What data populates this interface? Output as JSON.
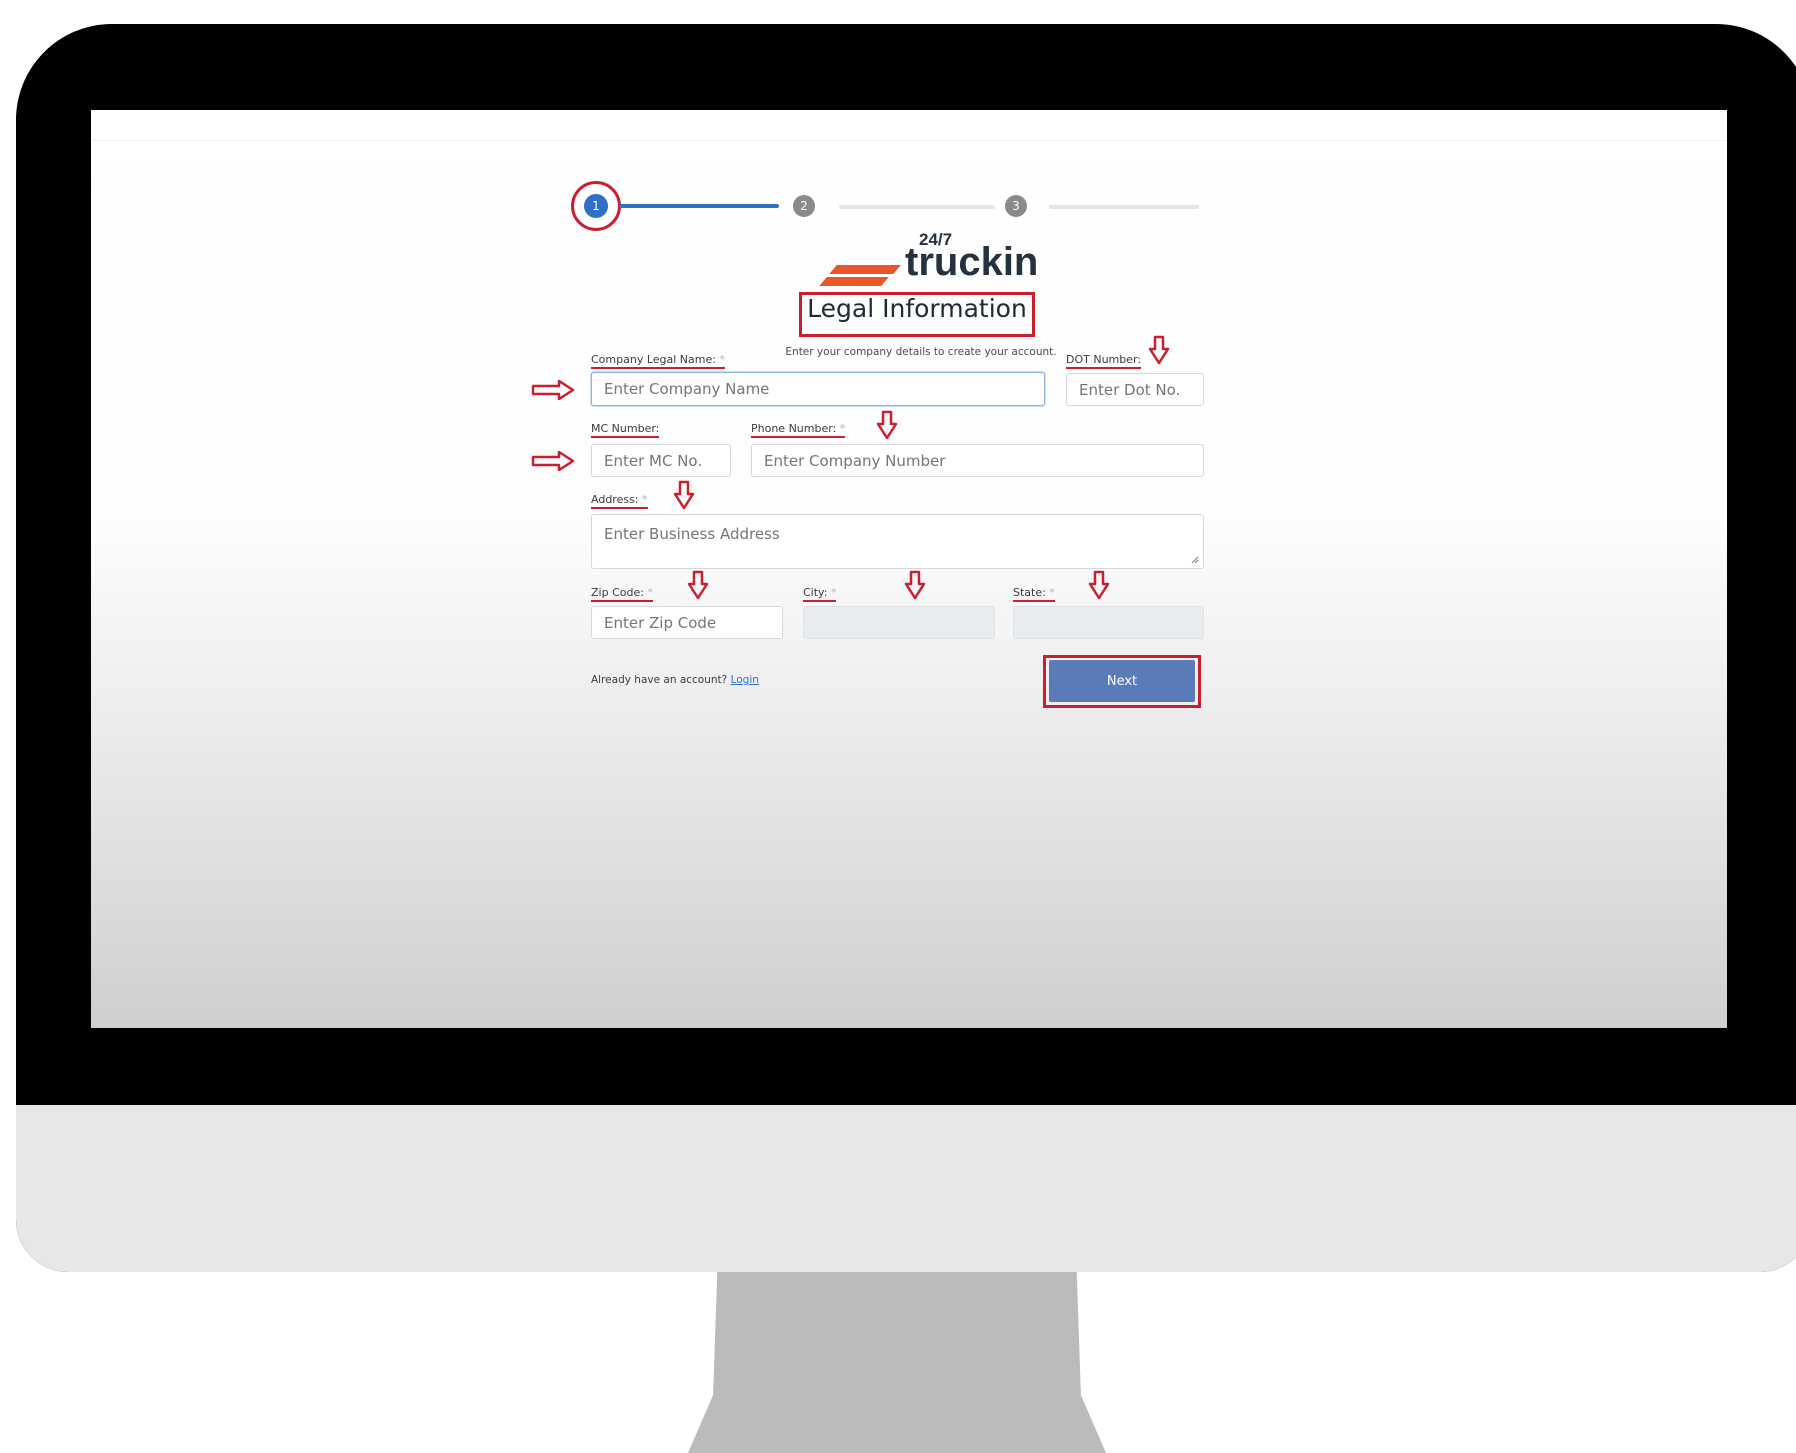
{
  "stepper": {
    "steps": [
      "1",
      "2",
      "3"
    ],
    "current": 1
  },
  "logo": {
    "superscript": "24/7",
    "wordmark": "truckin"
  },
  "header": {
    "title": "Legal Information",
    "subtitle": "Enter your company details to create your account."
  },
  "form": {
    "company_legal_name": {
      "label": "Company Legal Name:",
      "required_mark": "*",
      "placeholder": "Enter Company Name"
    },
    "dot_number": {
      "label": "DOT Number:",
      "placeholder": "Enter Dot No."
    },
    "mc_number": {
      "label": "MC Number:",
      "placeholder": "Enter MC No."
    },
    "phone_number": {
      "label": "Phone Number:",
      "required_mark": "*",
      "placeholder": "Enter Company Number"
    },
    "address": {
      "label": "Address:",
      "required_mark": "*",
      "placeholder": "Enter Business Address"
    },
    "zip_code": {
      "label": "Zip Code:",
      "required_mark": "*",
      "placeholder": "Enter Zip Code"
    },
    "city": {
      "label": "City:",
      "required_mark": "*"
    },
    "state": {
      "label": "State:",
      "required_mark": "*"
    }
  },
  "footer": {
    "already_text": "Already have an account?",
    "login_link": "Login",
    "next_button": "Next"
  },
  "colors": {
    "accent_blue": "#2f6fc4",
    "annotation_red": "#c8202f",
    "logo_orange": "#e8562a",
    "next_button": "#5a7bb8"
  },
  "icons": [
    "right-arrow-icon",
    "down-arrow-icon",
    "resize-grip-icon"
  ]
}
